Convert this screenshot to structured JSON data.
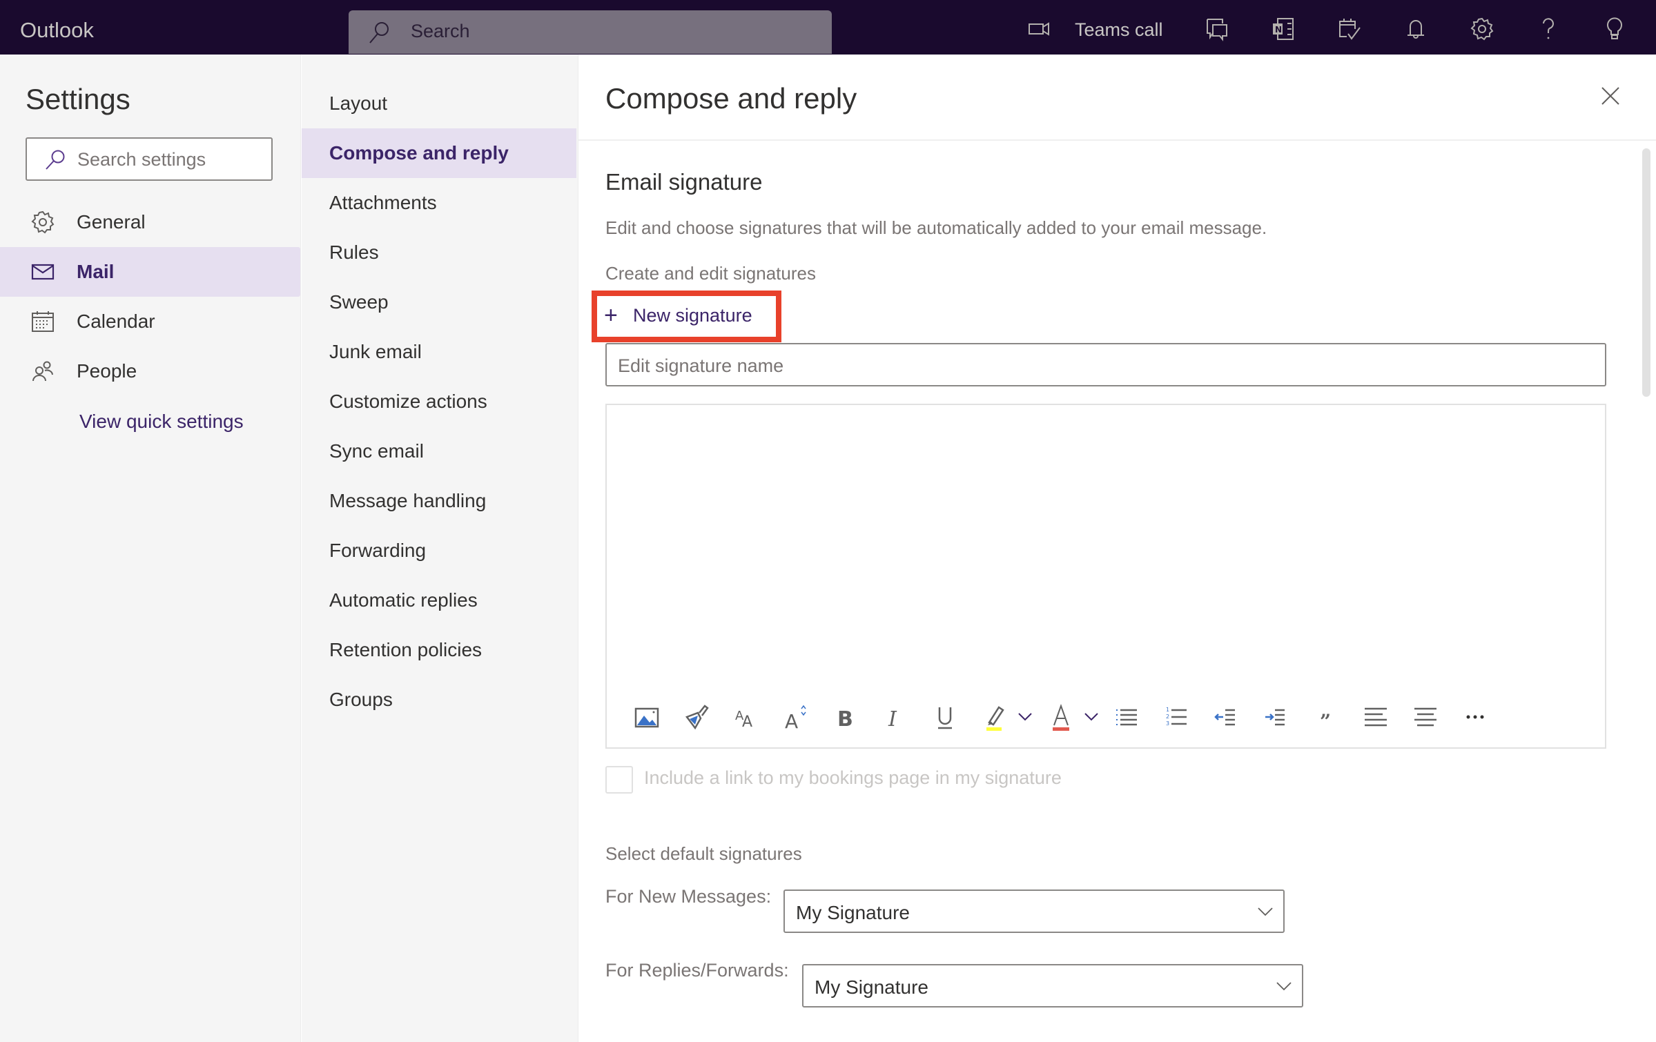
{
  "topbar": {
    "brand": "Outlook",
    "search_placeholder": "Search",
    "teams_call_label": "Teams call",
    "icons": [
      "video-icon",
      "chat-icon",
      "onenote-icon",
      "my-day-icon",
      "bell-icon",
      "gear-icon",
      "help-icon",
      "lightbulb-icon"
    ]
  },
  "settings_nav": {
    "title": "Settings",
    "search_placeholder": "Search settings",
    "items": [
      {
        "label": "General",
        "icon": "gear-icon"
      },
      {
        "label": "Mail",
        "icon": "mail-icon",
        "active": true
      },
      {
        "label": "Calendar",
        "icon": "calendar-icon"
      },
      {
        "label": "People",
        "icon": "people-icon"
      }
    ],
    "view_quick_settings": "View quick settings"
  },
  "mail_nav": {
    "items": [
      {
        "label": "Layout"
      },
      {
        "label": "Compose and reply",
        "active": true
      },
      {
        "label": "Attachments"
      },
      {
        "label": "Rules"
      },
      {
        "label": "Sweep"
      },
      {
        "label": "Junk email"
      },
      {
        "label": "Customize actions"
      },
      {
        "label": "Sync email"
      },
      {
        "label": "Message handling"
      },
      {
        "label": "Forwarding"
      },
      {
        "label": "Automatic replies"
      },
      {
        "label": "Retention policies"
      },
      {
        "label": "Groups"
      }
    ]
  },
  "main": {
    "title": "Compose and reply",
    "section_title": "Email signature",
    "description": "Edit and choose signatures that will be automatically added to your email message.",
    "create_label": "Create and edit signatures",
    "new_signature_label": "New signature",
    "signature_name_placeholder": "Edit signature name",
    "toolbar": [
      "insert-picture-icon",
      "format-painter-icon",
      "font-icon",
      "font-size-icon",
      "bold-icon",
      "italic-icon",
      "underline-icon",
      "highlight-icon",
      "font-color-icon",
      "bullets-icon",
      "numbering-icon",
      "decrease-indent-icon",
      "increase-indent-icon",
      "quote-icon",
      "align-left-icon",
      "align-center-icon",
      "more-icon"
    ],
    "bookings_checkbox_label": "Include a link to my bookings page in my signature",
    "bookings_checked": false,
    "default_signatures_label": "Select default signatures",
    "new_messages_label": "For New Messages:",
    "new_messages_value": "My Signature",
    "replies_label": "For Replies/Forwards:",
    "replies_value": "My Signature"
  },
  "colors": {
    "topbar": "#1a0a2e",
    "accent": "#3b2468",
    "active_bg": "#e6dff0",
    "highlight_box": "#e8412b"
  }
}
